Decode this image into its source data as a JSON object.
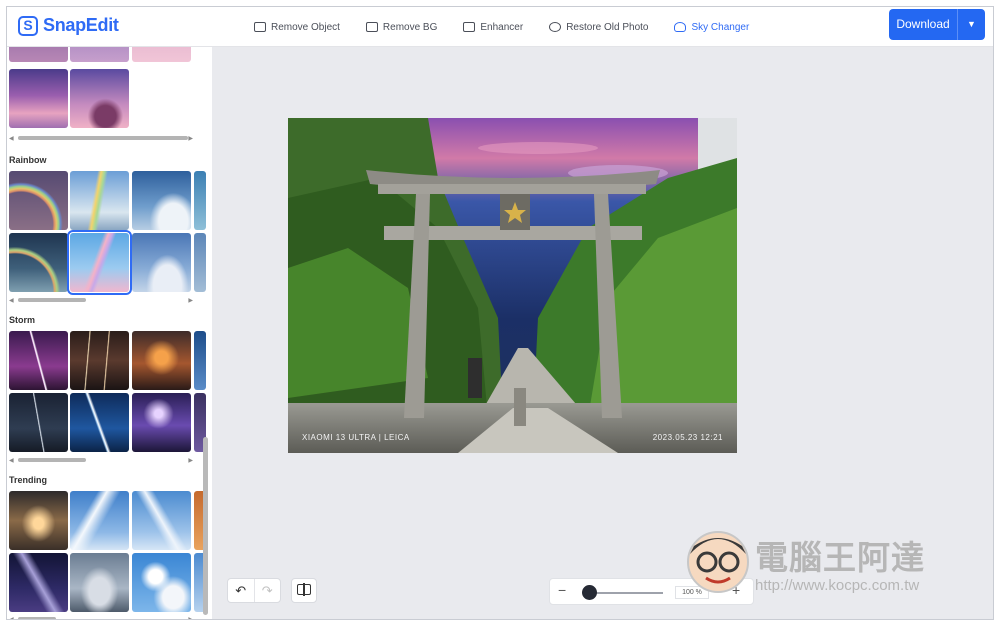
{
  "app": {
    "name": "SnapEdit"
  },
  "nav": [
    {
      "label": "Remove Object",
      "icon": "eraser-icon",
      "active": false
    },
    {
      "label": "Remove BG",
      "icon": "remove-bg-icon",
      "active": false
    },
    {
      "label": "Enhancer",
      "icon": "enhancer-icon",
      "active": false
    },
    {
      "label": "Restore Old Photo",
      "icon": "restore-photo-icon",
      "active": false
    },
    {
      "label": "Sky Changer",
      "icon": "sky-changer-icon",
      "active": true
    }
  ],
  "download": {
    "label": "Download",
    "menu_icon": "caret-down-icon"
  },
  "sidebar": {
    "categories": [
      {
        "name": "Rainbow"
      },
      {
        "name": "Storm"
      },
      {
        "name": "Trending"
      }
    ]
  },
  "photo": {
    "watermark_left": "XIAOMI 13 ULTRA | LEICA",
    "watermark_right": "2023.05.23 12:21"
  },
  "toolbar": {
    "undo_icon": "undo-icon",
    "redo_icon": "redo-icon",
    "compare_icon": "compare-icon"
  },
  "zoom": {
    "minus": "−",
    "plus": "+",
    "value": "100 %",
    "level": 0.0
  },
  "brand_overlay": {
    "name": "電腦王阿達",
    "url": "http://www.kocpc.com.tw"
  },
  "colors": {
    "accent": "#2f6bf5",
    "download": "#2468f2"
  }
}
